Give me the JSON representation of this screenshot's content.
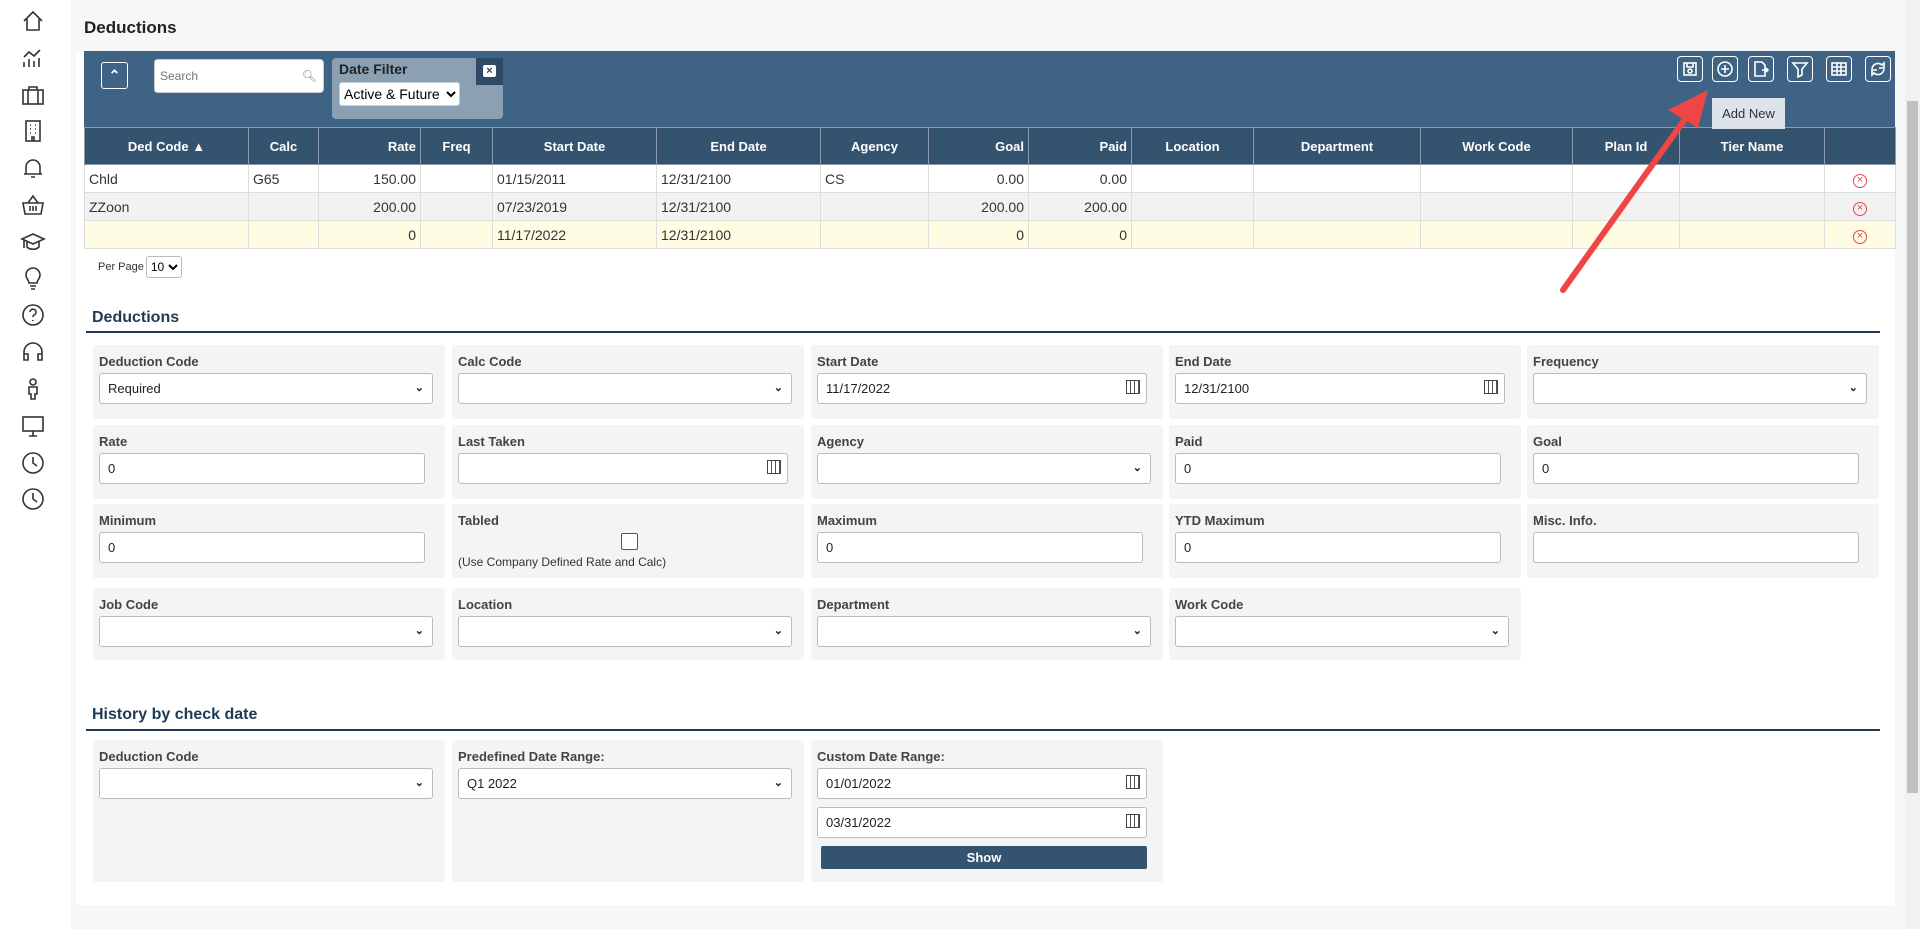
{
  "page_title": "Deductions",
  "sidebar": {
    "icons": [
      "home-icon",
      "analytics-icon",
      "briefcase-icon",
      "building-icon",
      "bell-icon",
      "basket-icon",
      "graduation-cap-icon",
      "lightbulb-icon",
      "help-icon",
      "headset-icon",
      "person-icon",
      "monitor-icon",
      "clock-icon",
      "clock-icon"
    ]
  },
  "toolbar": {
    "search_placeholder": "Search",
    "date_filter_label": "Date Filter",
    "date_filter_value": "Active & Future",
    "buttons": [
      "save-icon",
      "add-new-icon",
      "export-icon",
      "filter-icon",
      "columns-icon",
      "refresh-icon"
    ],
    "tooltip": "Add New"
  },
  "table": {
    "columns": [
      "Ded Code ▲",
      "Calc",
      "Rate",
      "Freq",
      "Start Date",
      "End Date",
      "Agency",
      "Goal",
      "Paid",
      "Location",
      "Department",
      "Work Code",
      "Plan Id",
      "Tier Name",
      ""
    ],
    "rows": [
      [
        "Chld",
        "G65",
        "150.00",
        "",
        "01/15/2011",
        "12/31/2100",
        "CS",
        "0.00",
        "0.00",
        "",
        "",
        "",
        "",
        ""
      ],
      [
        "ZZoon",
        "",
        "200.00",
        "",
        "07/23/2019",
        "12/31/2100",
        "",
        "200.00",
        "200.00",
        "",
        "",
        "",
        "",
        ""
      ],
      [
        "",
        "",
        "0",
        "",
        "11/17/2022",
        "12/31/2100",
        "",
        "0",
        "0",
        "",
        "",
        "",
        "",
        ""
      ]
    ],
    "per_page_label": "Per Page",
    "per_page_value": "10"
  },
  "deductions_form": {
    "title": "Deductions",
    "fields": [
      {
        "label": "Deduction Code",
        "type": "select",
        "value": "Required"
      },
      {
        "label": "Calc Code",
        "type": "select",
        "value": ""
      },
      {
        "label": "Start Date",
        "type": "date",
        "value": "11/17/2022"
      },
      {
        "label": "End Date",
        "type": "date",
        "value": "12/31/2100"
      },
      {
        "label": "Frequency",
        "type": "select",
        "value": ""
      },
      {
        "label": "Rate",
        "type": "text",
        "value": "0"
      },
      {
        "label": "Last Taken",
        "type": "date",
        "value": ""
      },
      {
        "label": "Agency",
        "type": "select",
        "value": ""
      },
      {
        "label": "Paid",
        "type": "text",
        "value": "0"
      },
      {
        "label": "Goal",
        "type": "text",
        "value": "0"
      },
      {
        "label": "Minimum",
        "type": "text",
        "value": "0"
      },
      {
        "label": "Tabled",
        "type": "checkbox",
        "value": "(Use Company Defined Rate and Calc)"
      },
      {
        "label": "Maximum",
        "type": "text",
        "value": "0"
      },
      {
        "label": "YTD Maximum",
        "type": "text",
        "value": "0"
      },
      {
        "label": "Misc. Info.",
        "type": "text",
        "value": ""
      },
      {
        "label": "Job Code",
        "type": "select",
        "value": ""
      },
      {
        "label": "Location",
        "type": "select",
        "value": ""
      },
      {
        "label": "Department",
        "type": "select",
        "value": ""
      },
      {
        "label": "Work Code",
        "type": "select",
        "value": ""
      }
    ]
  },
  "history": {
    "title": "History by check date",
    "deduction_code_label": "Deduction Code",
    "deduction_code_value": "",
    "predefined_label": "Predefined Date Range:",
    "predefined_value": "Q1 2022",
    "custom_label": "Custom Date Range:",
    "custom_from": "01/01/2022",
    "custom_to": "03/31/2022",
    "show_label": "Show"
  },
  "colors": {
    "toolbar": "#3f6384",
    "header": "#34536f",
    "accent": "#1e3a56",
    "delete": "#e0484b",
    "annotation_arrow": "#f04545"
  }
}
